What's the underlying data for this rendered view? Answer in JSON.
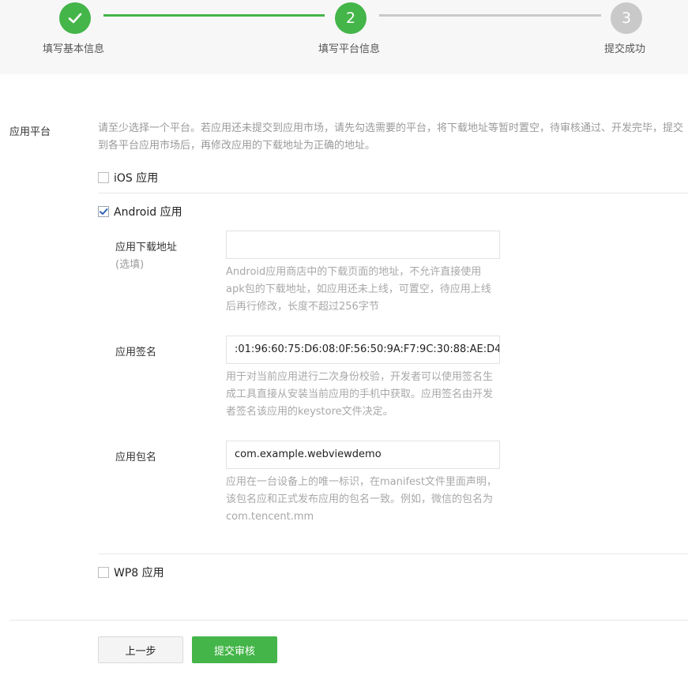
{
  "steps": [
    {
      "number": "",
      "label": "填写基本信息",
      "status": "done"
    },
    {
      "number": "2",
      "label": "填写平台信息",
      "status": "active"
    },
    {
      "number": "3",
      "label": "提交成功",
      "status": "pending"
    }
  ],
  "colors": {
    "accent": "#44b549",
    "pending": "#c9c9c9"
  },
  "platform": {
    "label": "应用平台",
    "hint": "请至少选择一个平台。若应用还未提交到应用市场，请先勾选需要的平台，将下载地址等暂时置空，待审核通过、开发完毕，提交到各平台应用市场后，再修改应用的下载地址为正确的地址。",
    "ios": {
      "label": "iOS 应用",
      "checked": false
    },
    "android": {
      "label": "Android 应用",
      "checked": true
    },
    "wp8": {
      "label": "WP8 应用",
      "checked": false
    }
  },
  "android_fields": {
    "download_url": {
      "label": "应用下载地址",
      "sub": "(选填)",
      "value": "",
      "help": "Android应用商店中的下载页面的地址，不允许直接使用apk包的下载地址，如应用还未上线，可置空，待应用上线后再行修改，长度不超过256字节"
    },
    "signature": {
      "label": "应用签名",
      "value": ":01:96:60:75:D6:08:0F:56:50:9A:F7:9C:30:88:AE:D4",
      "help": "用于对当前应用进行二次身份校验，开发者可以使用签名生成工具直接从安装当前应用的手机中获取。应用签名由开发者签名该应用的keystore文件决定。"
    },
    "package": {
      "label": "应用包名",
      "value": "com.example.webviewdemo",
      "help": "应用在一台设备上的唯一标识，在manifest文件里面声明，该包名应和正式发布应用的包名一致。例如，微信的包名为com.tencent.mm"
    }
  },
  "buttons": {
    "prev": "上一步",
    "submit": "提交审核"
  }
}
